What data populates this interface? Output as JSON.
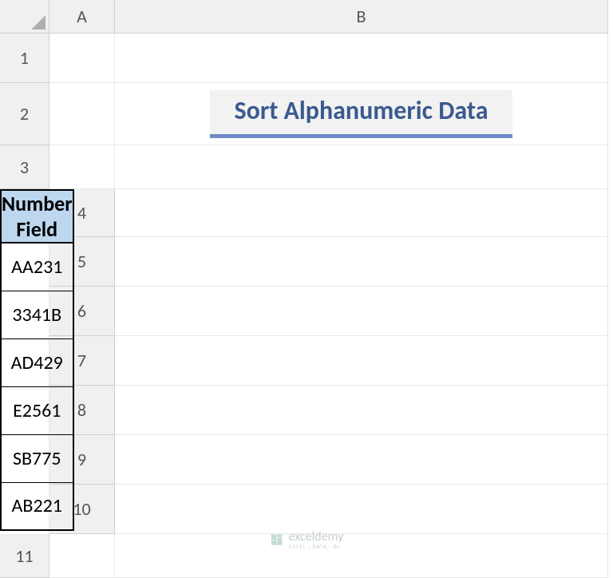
{
  "columns": [
    "A",
    "B"
  ],
  "rows": [
    "1",
    "2",
    "3",
    "4",
    "5",
    "6",
    "7",
    "8",
    "9",
    "10",
    "11"
  ],
  "title": "Sort Alphanumeric Data",
  "table": {
    "header": "Number Field",
    "data": [
      "AA231",
      "3341B",
      "AD429",
      "E2561",
      "SB775",
      "AB221"
    ]
  },
  "watermark": {
    "name": "exceldemy",
    "tagline": "EXCEL · DATA · BI"
  },
  "chart_data": {
    "type": "table",
    "title": "Sort Alphanumeric Data",
    "columns": [
      "Number Field"
    ],
    "rows": [
      [
        "AA231"
      ],
      [
        "3341B"
      ],
      [
        "AD429"
      ],
      [
        "E2561"
      ],
      [
        "SB775"
      ],
      [
        "AB221"
      ]
    ]
  }
}
